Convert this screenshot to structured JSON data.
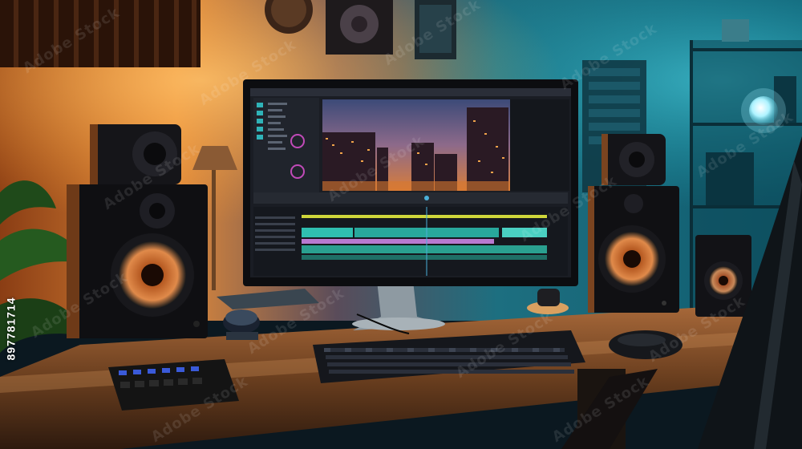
{
  "photo": {
    "stock_id": "897781714",
    "watermark_text": "Adobe Stock"
  },
  "palette": {
    "warm_light": "#ff9a2e",
    "cool_light": "#1fb5c9",
    "wood": "#7a4a22",
    "speaker_cone": "#d9793a"
  },
  "icons": [
    "desktop-monitor-icon",
    "speaker-icon",
    "keyboard-icon",
    "mouse-icon",
    "table-lamp-icon",
    "audio-mixer-icon",
    "globe-lamp-icon"
  ]
}
